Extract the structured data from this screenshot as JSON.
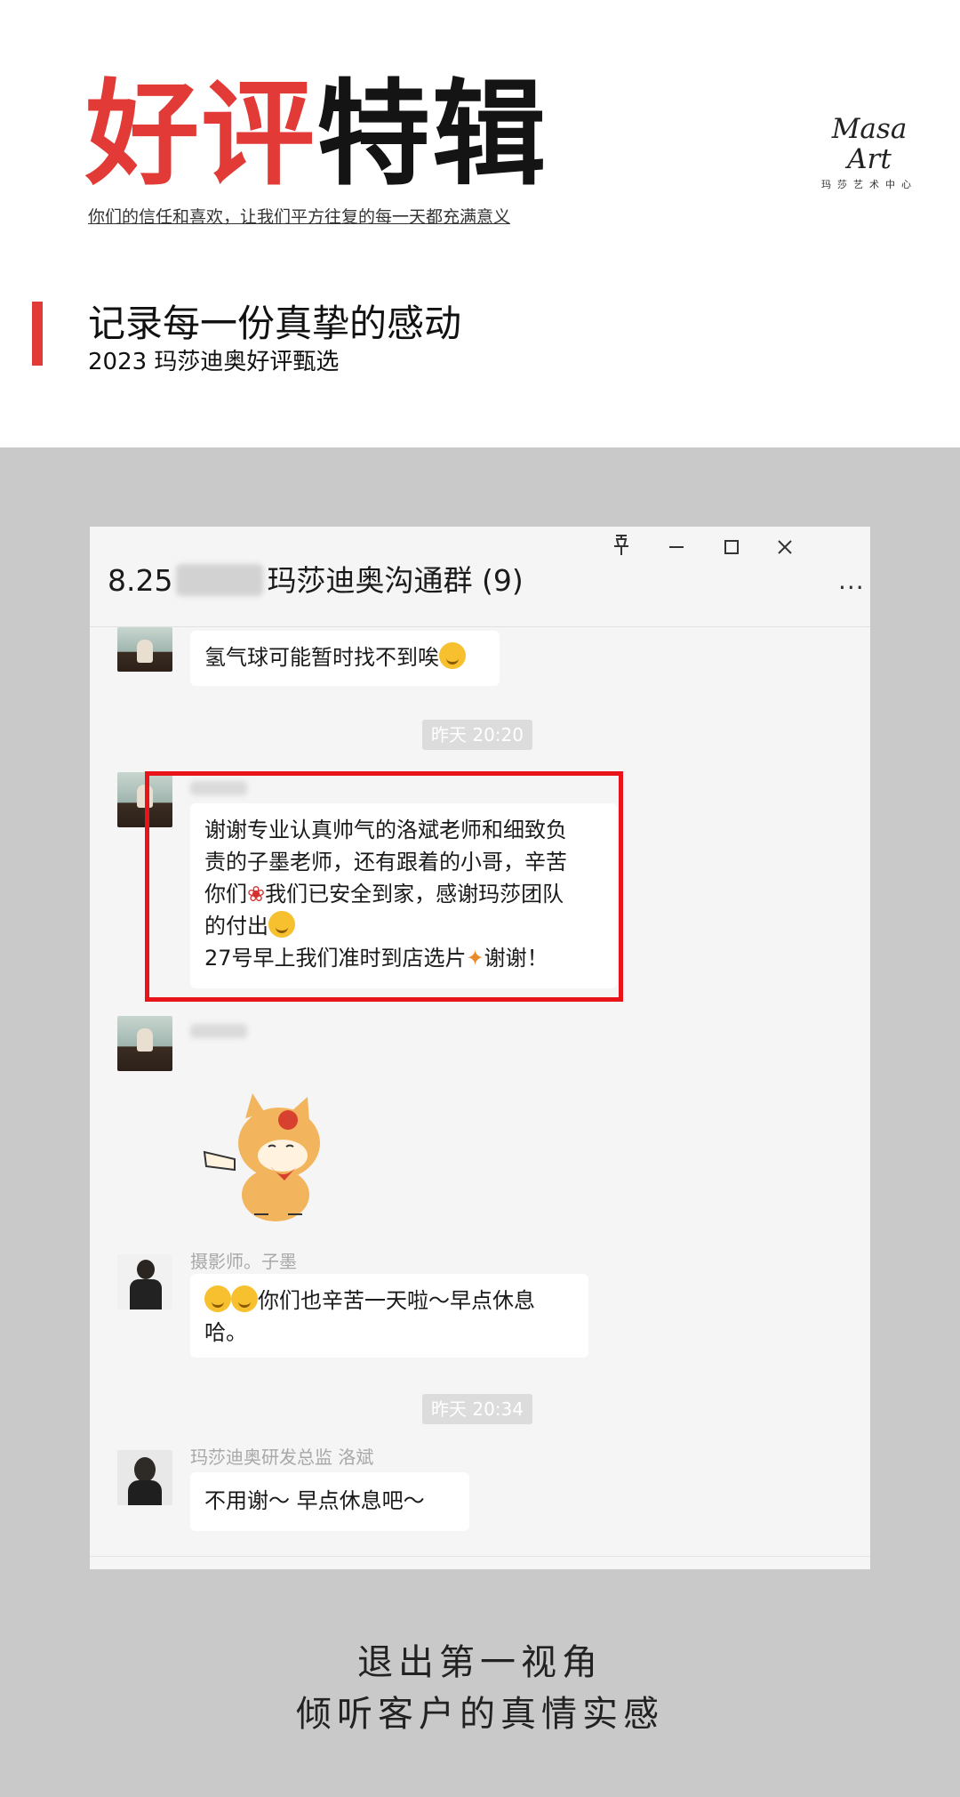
{
  "header": {
    "title_red": "好评",
    "title_black": "特辑",
    "subtitle": "你们的信任和喜欢，让我们平方往复的每一天都充满意义",
    "logo_script": "Masa Art",
    "logo_cn": "玛莎艺术中心",
    "section_title": "记录每一份真挚的感动",
    "section_subtitle": "2023 玛莎迪奥好评甄选"
  },
  "window": {
    "title_prefix": "8.25",
    "title_suffix": "玛莎迪奥沟通群 (9)",
    "controls": {
      "pin": "⊥",
      "minimize": "—",
      "maximize": "☐",
      "close": "✕",
      "more": "···"
    }
  },
  "chat": {
    "msg_balloon": "氢气球可能暂时找不到唉",
    "time_1": "昨天 20:20",
    "msg_thanks_line1": "谢谢专业认真帅气的洛斌老师和细致负",
    "msg_thanks_line2": "责的子墨老师，还有跟着的小哥，辛苦",
    "msg_thanks_line3a": "你们",
    "msg_thanks_line3b": "我们已安全到家，感谢玛莎团队",
    "msg_thanks_line4": "的付出",
    "msg_thanks_line5a": "27号早上我们准时到店选片",
    "msg_thanks_line5b": "谢谢！",
    "sender_photographer": "摄影师。子墨",
    "msg_photographer_line1": "你们也辛苦一天啦～早点休息",
    "msg_photographer_line2": "哈。",
    "time_2": "昨天 20:34",
    "sender_director": "玛莎迪奥研发总监 洛斌",
    "msg_director": "不用谢～  早点休息吧～"
  },
  "footer": {
    "line1": "退出第一视角",
    "line2": "倾听客户的真情实感"
  },
  "colors": {
    "accent_red": "#e23b37",
    "highlight_red": "#e8141a",
    "grey_bg": "#c9c9c9"
  }
}
